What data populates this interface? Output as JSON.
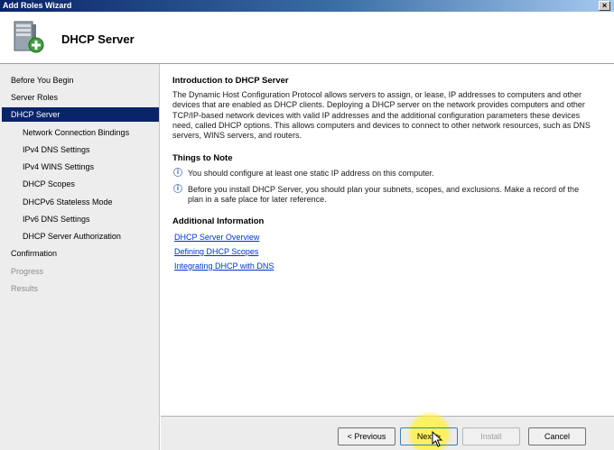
{
  "window": {
    "title": "Add Roles Wizard",
    "close_glyph": "×"
  },
  "header": {
    "title": "DHCP Server",
    "icon": "server-add-icon"
  },
  "sidebar": {
    "items": [
      {
        "label": "Before You Begin"
      },
      {
        "label": "Server Roles"
      },
      {
        "label": "DHCP Server"
      },
      {
        "label": "Network Connection Bindings"
      },
      {
        "label": "IPv4 DNS Settings"
      },
      {
        "label": "IPv4 WINS Settings"
      },
      {
        "label": "DHCP Scopes"
      },
      {
        "label": "DHCPv6 Stateless Mode"
      },
      {
        "label": "IPv6 DNS Settings"
      },
      {
        "label": "DHCP Server Authorization"
      },
      {
        "label": "Confirmation"
      },
      {
        "label": "Progress"
      },
      {
        "label": "Results"
      }
    ]
  },
  "content": {
    "intro_title": "Introduction to DHCP Server",
    "intro_text": "The Dynamic Host Configuration Protocol allows servers to assign, or lease, IP addresses to computers and other devices that are enabled as DHCP clients. Deploying a DHCP server on the network provides computers and other TCP/IP-based network devices with valid IP addresses and the additional configuration parameters these devices need, called DHCP options. This allows computers and devices to connect to other network resources, such as DNS servers, WINS servers, and routers.",
    "notes_title": "Things to Note",
    "notes": [
      "You should configure at least one static IP address on this computer.",
      "Before you install DHCP Server, you should plan your subnets, scopes, and exclusions. Make a record of the plan in a safe place for later reference."
    ],
    "additional_title": "Additional Information",
    "links": [
      "DHCP Server Overview",
      "Defining DHCP Scopes",
      "Integrating DHCP with DNS"
    ]
  },
  "footer": {
    "previous_label": "< Previous",
    "next_label": "Next >",
    "install_label": "Install",
    "cancel_label": "Cancel"
  }
}
